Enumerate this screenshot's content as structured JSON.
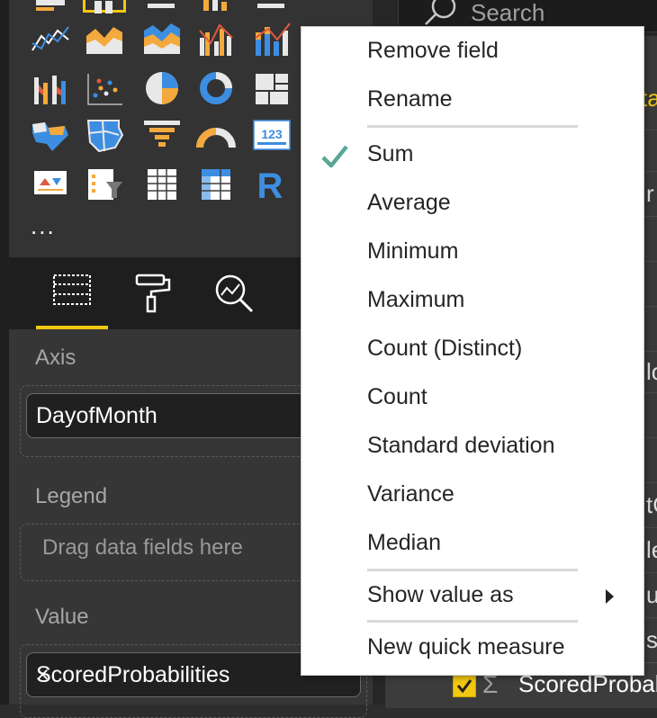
{
  "visualizations": {
    "more_label": "...",
    "icons": [
      "line-chart-icon",
      "area-chart-icon",
      "stacked-area-chart-icon",
      "line-clustered-column-icon",
      "line-stacked-column-icon",
      "ribbon-chart-icon",
      "waterfall-chart-icon",
      "scatter-chart-icon",
      "pie-chart-icon",
      "donut-chart-icon",
      "treemap-icon",
      "filled-map-icon",
      "shape-map-icon",
      "funnel-icon",
      "gauge-icon",
      "card-icon",
      "kpi-icon",
      "slicer-icon",
      "table-icon",
      "matrix-icon",
      "r-visual-icon"
    ],
    "r_letter": "R",
    "card_value": "123",
    "section_tabs": [
      "fields-tab",
      "format-tab",
      "analytics-tab"
    ]
  },
  "wells": {
    "axis": {
      "label": "Axis",
      "field": "DayofMonth"
    },
    "legend": {
      "label": "Legend",
      "placeholder": "Drag data fields here"
    },
    "value": {
      "label": "Value",
      "field": "ScoredProbabilities"
    },
    "remove_glyph": "×"
  },
  "fields_pane": {
    "search_placeholder": "Search",
    "peek_texts": [
      "ta",
      "r",
      "lo",
      "tC",
      "le",
      "uc",
      "s"
    ],
    "selected_field": {
      "sigma": "Σ",
      "name": "ScoredProbab"
    }
  },
  "context_menu": {
    "items": [
      {
        "label": "Remove field",
        "checked": false
      },
      {
        "label": "Rename",
        "checked": false
      },
      {
        "label": "Sum",
        "checked": true
      },
      {
        "label": "Average",
        "checked": false
      },
      {
        "label": "Minimum",
        "checked": false
      },
      {
        "label": "Maximum",
        "checked": false
      },
      {
        "label": "Count (Distinct)",
        "checked": false
      },
      {
        "label": "Count",
        "checked": false
      },
      {
        "label": "Standard deviation",
        "checked": false
      },
      {
        "label": "Variance",
        "checked": false
      },
      {
        "label": "Median",
        "checked": false
      },
      {
        "label": "Show value as",
        "checked": false,
        "submenu": true
      },
      {
        "label": "New quick measure",
        "checked": false
      }
    ],
    "check_color": "#5aa596"
  },
  "colors": {
    "accent_yellow": "#f2c811",
    "pane_bg": "#333333",
    "menu_bg": "#ffffff"
  }
}
